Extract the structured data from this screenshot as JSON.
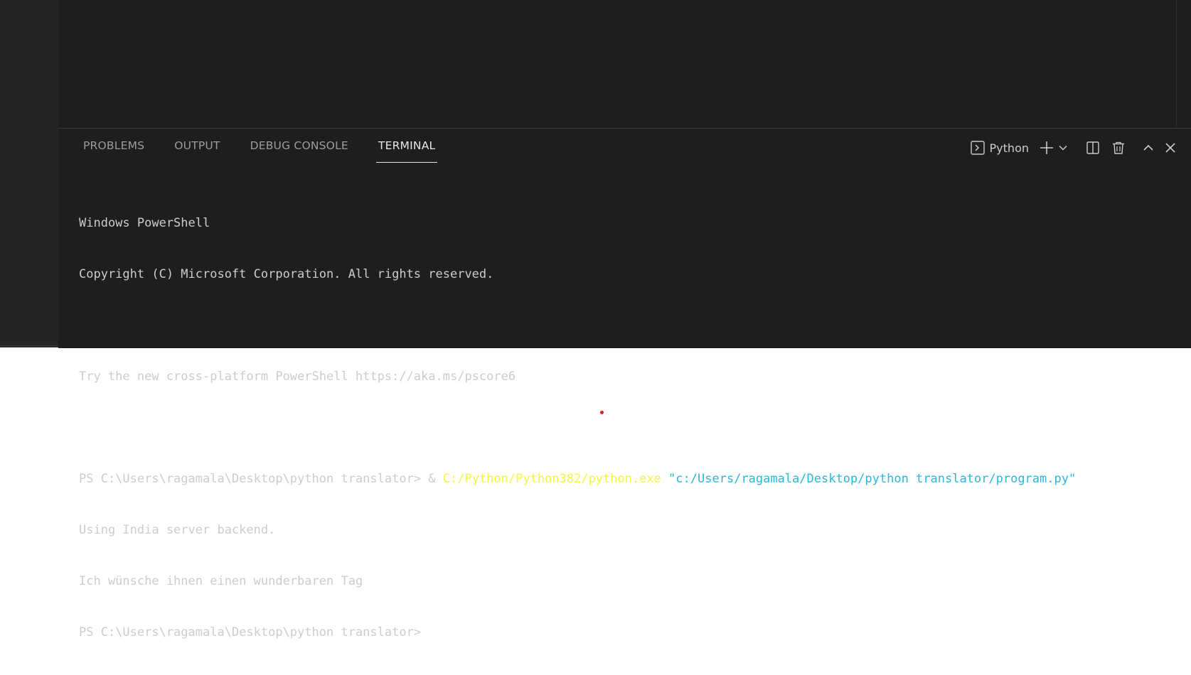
{
  "panel": {
    "tabs": [
      {
        "label": "PROBLEMS"
      },
      {
        "label": "OUTPUT"
      },
      {
        "label": "DEBUG CONSOLE"
      },
      {
        "label": "TERMINAL",
        "active": true
      }
    ],
    "actions": {
      "shell_name": "Python",
      "icons": [
        "terminal-icon",
        "plus-icon",
        "chevron-down-icon",
        "split-icon",
        "trash-icon",
        "chevron-up-icon",
        "close-icon"
      ]
    }
  },
  "terminal": {
    "line1": "Windows PowerShell",
    "line2": "Copyright (C) Microsoft Corporation. All rights reserved.",
    "line3": "",
    "line4": "Try the new cross-platform PowerShell https://aka.ms/pscore6",
    "line5": "",
    "line6": {
      "prompt": "PS C:\\Users\\ragamala\\Desktop\\python translator> & ",
      "exe": "C:/Python/Python382/python.exe",
      "space": " ",
      "arg": "\"c:/Users/ragamala/Desktop/python translator/program.py\""
    },
    "line7": "Using India server backend.",
    "line8": "Ich wünsche ihnen einen wunderbaren Tag",
    "line9": "PS C:\\Users\\ragamala\\Desktop\\python translator>"
  },
  "colors": {
    "background": "#1e1e1e",
    "text": "#cccccc",
    "exe_yellow": "#f5f543",
    "string_cyan": "#29b8db",
    "active_tab": "#e7e7e7"
  }
}
